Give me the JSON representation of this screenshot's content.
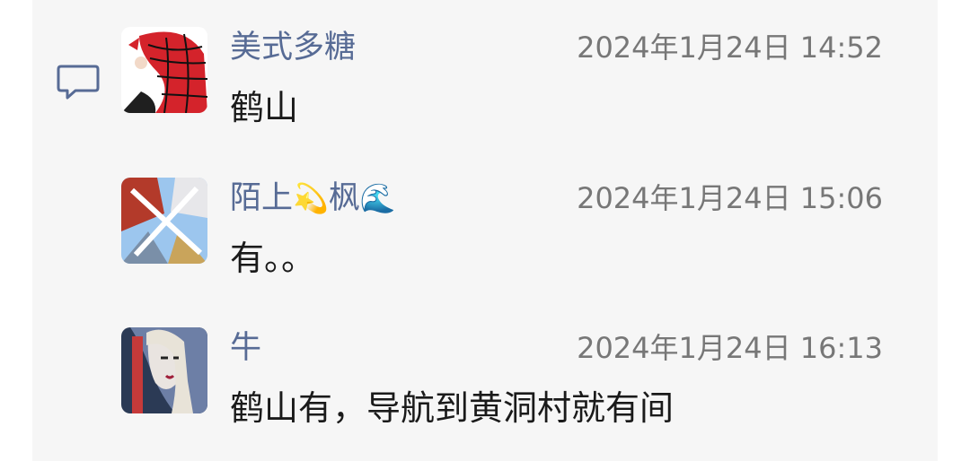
{
  "comments": [
    {
      "name": "美式多糖",
      "time": "2024年1月24日 14:52",
      "text": "鹤山"
    },
    {
      "name_parts": [
        "陌上",
        "💫",
        "枫",
        "🌊"
      ],
      "time": "2024年1月24日 15:06",
      "text": "有。。"
    },
    {
      "name": "牛",
      "time": "2024年1月24日 16:13",
      "text": "鹤山有，导航到黄洞村就有间"
    }
  ],
  "icons": {
    "comment": "comment-icon",
    "accent_color": "#576b95"
  }
}
